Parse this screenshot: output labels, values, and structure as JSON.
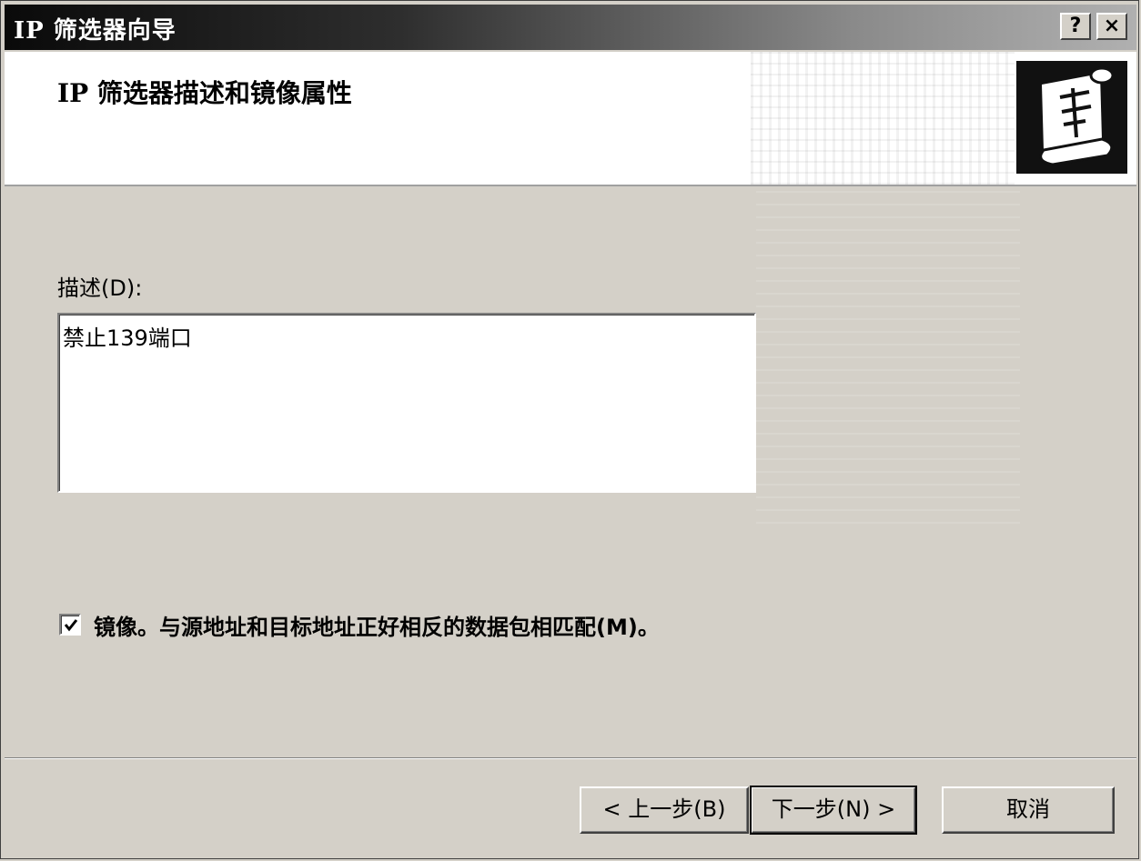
{
  "window": {
    "title": "IP 筛选器向导",
    "help_label": "?",
    "close_label": "×"
  },
  "header": {
    "title": "IP 筛选器描述和镜像属性",
    "icon": "scroll-wizard-icon"
  },
  "description": {
    "label": "描述(D):",
    "value": "禁止139端口"
  },
  "mirror": {
    "checked": true,
    "label": "镜像。与源地址和目标地址正好相反的数据包相匹配(M)。"
  },
  "buttons": {
    "back": "< 上一步(B)",
    "next": "下一步(N) >",
    "cancel": "取消"
  }
}
